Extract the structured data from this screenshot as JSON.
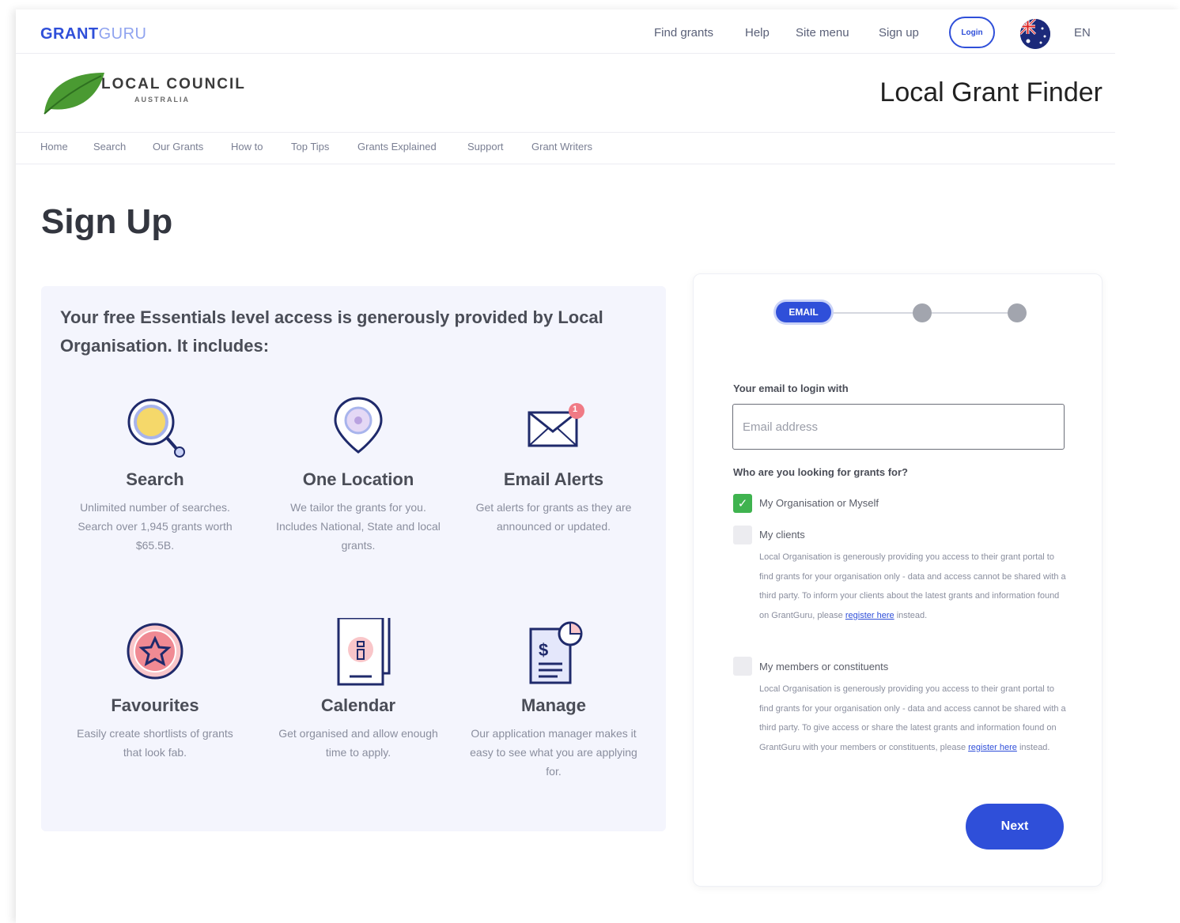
{
  "topbar": {
    "brand_a": "GRANT",
    "brand_b": "GURU",
    "nav": [
      "Find grants",
      "Help",
      "Site menu",
      "Sign up"
    ],
    "login_label": "Login",
    "language": "EN"
  },
  "council": {
    "name": "LOCAL COUNCIL",
    "sub": "AUSTRALIA",
    "title": "Local Grant Finder",
    "leaf_color": "#4a9a32"
  },
  "subnav": [
    "Home",
    "Search",
    "Our Grants",
    "How to",
    "Top Tips",
    "Grants Explained",
    "Support",
    "Grant Writers"
  ],
  "page_title": "Sign Up",
  "benefits": {
    "heading": "Your free Essentials level access is generously provided by Local Organisation. It includes:",
    "features": [
      {
        "icon": "search-icon",
        "title": "Search",
        "desc": "Unlimited number of searches. Search over 1,945 grants worth $65.5B."
      },
      {
        "icon": "location-pin-icon",
        "title": "One Location",
        "desc": "We tailor the grants for you. Includes National, State and local grants."
      },
      {
        "icon": "envelope-icon",
        "title": "Email Alerts",
        "desc": "Get alerts for grants as they are announced or updated."
      },
      {
        "icon": "star-badge-icon",
        "title": "Favourites",
        "desc": "Easily create shortlists of grants that look fab."
      },
      {
        "icon": "calendar-icon",
        "title": "Calendar",
        "desc": "Get organised and allow enough time to apply."
      },
      {
        "icon": "manage-document-icon",
        "title": "Manage",
        "desc": "Our application manager makes it easy to see what you are applying for."
      }
    ],
    "email_badge": "1"
  },
  "form": {
    "step_label": "EMAIL",
    "email_label": "Your email to login with",
    "email_placeholder": "Email address",
    "email_value": "",
    "who_label": "Who are you looking for grants for?",
    "options": [
      {
        "label": "My Organisation or Myself",
        "checked": true
      },
      {
        "label": "My clients",
        "checked": false,
        "desc": "Local Organisation is generously providing you access to their grant portal to find grants for your organisation only - data and access cannot be shared with a third party. To inform your clients about the latest grants and information found on GrantGuru, please",
        "link": "register here",
        "tail": "instead."
      },
      {
        "label": "My members or constituents",
        "checked": false,
        "desc": "Local Organisation is generously providing you access to their grant portal to find grants for your organisation only - data and access cannot be shared with a third party. To give access or share the latest grants and information found on GrantGuru with your members or constituents, please",
        "link": "register here",
        "tail": "instead."
      }
    ],
    "next_label": "Next"
  },
  "colors": {
    "accent": "#2f4fd9",
    "check": "#3fb34f",
    "panel": "#f4f5fd"
  }
}
